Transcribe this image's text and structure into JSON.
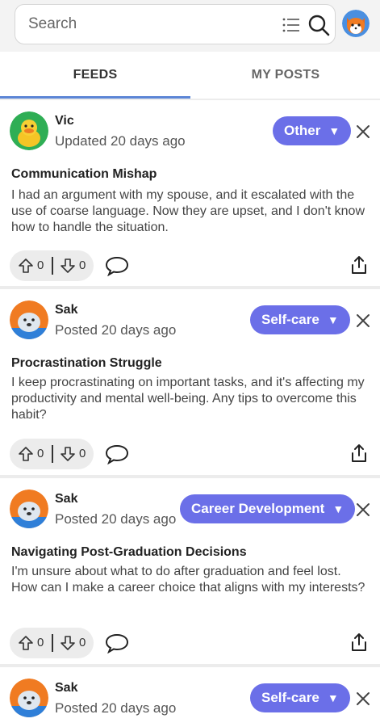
{
  "search": {
    "placeholder": "Search"
  },
  "tabs": [
    {
      "label": "FEEDS"
    },
    {
      "label": "MY POSTS"
    }
  ],
  "posts": [
    {
      "user": "Vic",
      "meta": "Updated 20 days ago",
      "category": "Other",
      "title": "Communication Mishap",
      "body": "I had an argument with my spouse, and it escalated with the use of coarse language. Now they are upset, and I don't know how to handle the situation.",
      "upvotes": "0",
      "downvotes": "0",
      "avatar": "duck"
    },
    {
      "user": "Sak",
      "meta": "Posted 20 days ago",
      "category": "Self-care",
      "title": "Procrastination Struggle",
      "body": "I keep procrastinating on important tasks, and it's affecting my productivity and mental well-being. Any tips to overcome this habit?",
      "upvotes": "0",
      "downvotes": "0",
      "avatar": "seal"
    },
    {
      "user": "Sak",
      "meta": "Posted 20 days ago",
      "category": "Career Development",
      "title": "Navigating Post-Graduation Decisions",
      "body": "I'm unsure about what to do after graduation and feel lost. How can I make a career choice that aligns with my interests?",
      "upvotes": "0",
      "downvotes": "0",
      "avatar": "seal"
    },
    {
      "user": "Sak",
      "meta": "Posted 20 days ago",
      "category": "Self-care",
      "avatar": "seal"
    }
  ],
  "colors": {
    "accent": "#6b6fe8",
    "tab_underline": "#5c86d6"
  }
}
